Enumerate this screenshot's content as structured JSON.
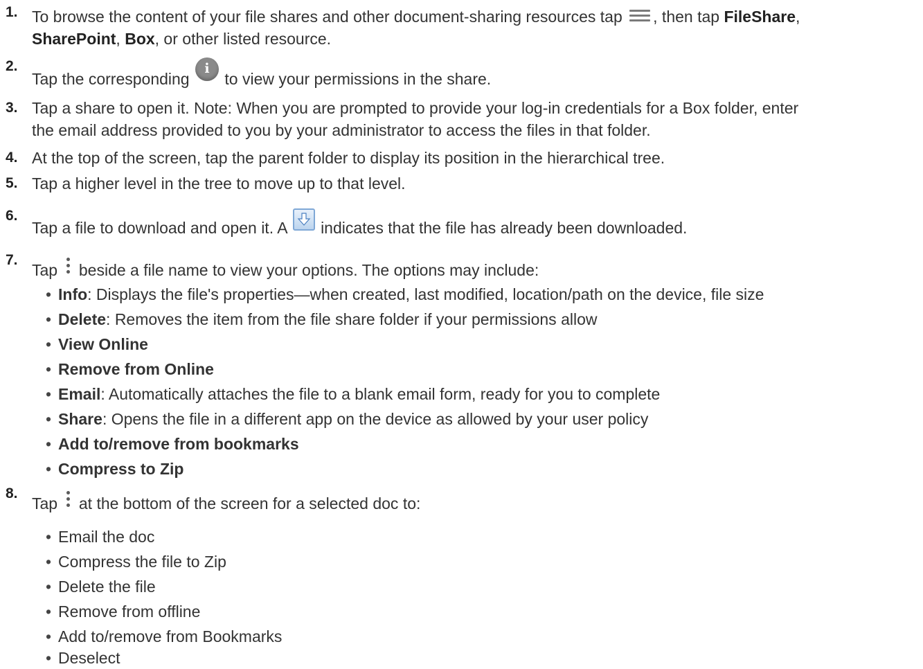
{
  "steps": [
    {
      "num": "1.",
      "parts": [
        "To browse the content of your file shares and other document-sharing resources tap",
        ", then tap",
        "FileShare",
        ",",
        "SharePoint",
        ",",
        "Box",
        ", or other listed resource."
      ]
    },
    {
      "num": "2.",
      "parts": [
        "Tap the corresponding",
        "to view your permissions in the share."
      ]
    },
    {
      "num": "3.",
      "lines": [
        "Tap a share to open it. Note: When you are prompted to provide your log-in credentials for a Box folder, enter",
        "the email address provided to you by your administrator to access the files in that folder."
      ]
    },
    {
      "num": "4.",
      "text": "At the top of the screen, tap the parent folder to display its position in the hierarchical tree."
    },
    {
      "num": "5.",
      "text": "Tap a higher level in the tree to move up to that level."
    },
    {
      "num": "6.",
      "parts": [
        "Tap a file to download and open it. A",
        "indicates that the file has already been downloaded."
      ]
    },
    {
      "num": "7.",
      "parts": [
        "Tap",
        "beside a file name to view your options. The options may include:"
      ],
      "bullets": [
        {
          "bold": "Info",
          "text": ": Displays the file's properties—when created, last modified, location/path on the device, file size"
        },
        {
          "bold": "Delete",
          "text": ": Removes the item from the file share folder if your permissions allow"
        },
        {
          "bold": "View Online",
          "text": ""
        },
        {
          "bold": "Remove from Online",
          "text": ""
        },
        {
          "bold": "Email",
          "text": ": Automatically attaches the file to a blank email form, ready for you to complete"
        },
        {
          "bold": "Share",
          "text": ": Opens the file in a different app on the device as allowed by your user policy"
        },
        {
          "bold": "Add to/remove from bookmarks",
          "text": ""
        },
        {
          "bold": "Compress to Zip",
          "text": ""
        }
      ]
    },
    {
      "num": "8.",
      "parts": [
        "Tap",
        "at the bottom of the screen for a selected doc to:"
      ],
      "bullets": [
        {
          "bold": "",
          "text": "Email the doc"
        },
        {
          "bold": "",
          "text": "Compress the file to Zip"
        },
        {
          "bold": "",
          "text": "Delete the file"
        },
        {
          "bold": "",
          "text": "Remove from offline"
        },
        {
          "bold": "",
          "text": "Add to/remove from Bookmarks"
        },
        {
          "bold": "",
          "text": "Deselect"
        }
      ]
    }
  ],
  "bullet_char": "•",
  "icons": {
    "menu": "hamburger-menu-icon",
    "info": "info-icon",
    "downloaded": "download-icon",
    "more": "more-vertical-icon"
  },
  "colors": {
    "text": "#333333",
    "icon_gray": "#8a8a8a",
    "download_blue": "#7fa8d6"
  }
}
